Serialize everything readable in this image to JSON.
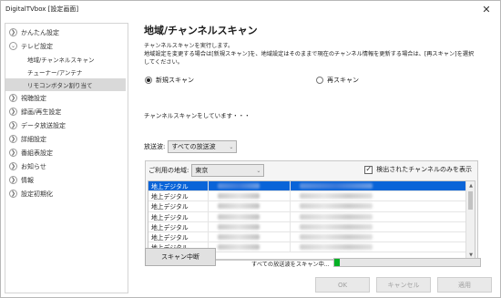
{
  "window": {
    "title": "DigitalTVbox [設定画面]"
  },
  "sidebar": {
    "items": [
      {
        "label": "かんたん設定"
      },
      {
        "label": "テレビ設定",
        "children": [
          {
            "label": "地域/チャンネルスキャン"
          },
          {
            "label": "チューナー/アンテナ"
          },
          {
            "label": "リモコンボタン割り当て",
            "active": true
          }
        ]
      },
      {
        "label": "視聴設定"
      },
      {
        "label": "録画/再生設定"
      },
      {
        "label": "データ放送設定"
      },
      {
        "label": "詳細設定"
      },
      {
        "label": "番組表設定"
      },
      {
        "label": "お知らせ"
      },
      {
        "label": "情報"
      },
      {
        "label": "設定初期化"
      }
    ]
  },
  "main": {
    "heading": "地域/チャンネルスキャン",
    "desc_lines": [
      "チャンネルスキャンを実行します。",
      "地域設定を変更する場合は[新規スキャン]を、地域設定はそのままで現在のチャンネル情報を更新する場合は、[再スキャン]を選択",
      "してください。"
    ],
    "radio_new": "新規スキャン",
    "radio_rescan": "再スキャン",
    "selected_radio": "new",
    "status": "チャンネルスキャンをしています・・・",
    "wave_label": "放送波:",
    "wave_value": "すべての放送波",
    "region_label": "ご利用の地域:",
    "region_value": "東京",
    "only_detected_label": "検出されたチャンネルのみを表示",
    "only_detected_checked": true,
    "channel_rows": [
      {
        "type": "地上デジタル",
        "selected": true
      },
      {
        "type": "地上デジタル"
      },
      {
        "type": "地上デジタル"
      },
      {
        "type": "地上デジタル"
      },
      {
        "type": "地上デジタル"
      },
      {
        "type": "地上デジタル"
      },
      {
        "type": "地上デジタル"
      }
    ],
    "stop_button": "スキャン中断",
    "progress_text": "すべての放送波をスキャン中...",
    "progress_percent": 4
  },
  "footer": {
    "ok": "OK",
    "cancel": "キャンセル",
    "apply": "適用"
  },
  "colors": {
    "selection": "#0a64d8",
    "progress": "#06b025"
  }
}
